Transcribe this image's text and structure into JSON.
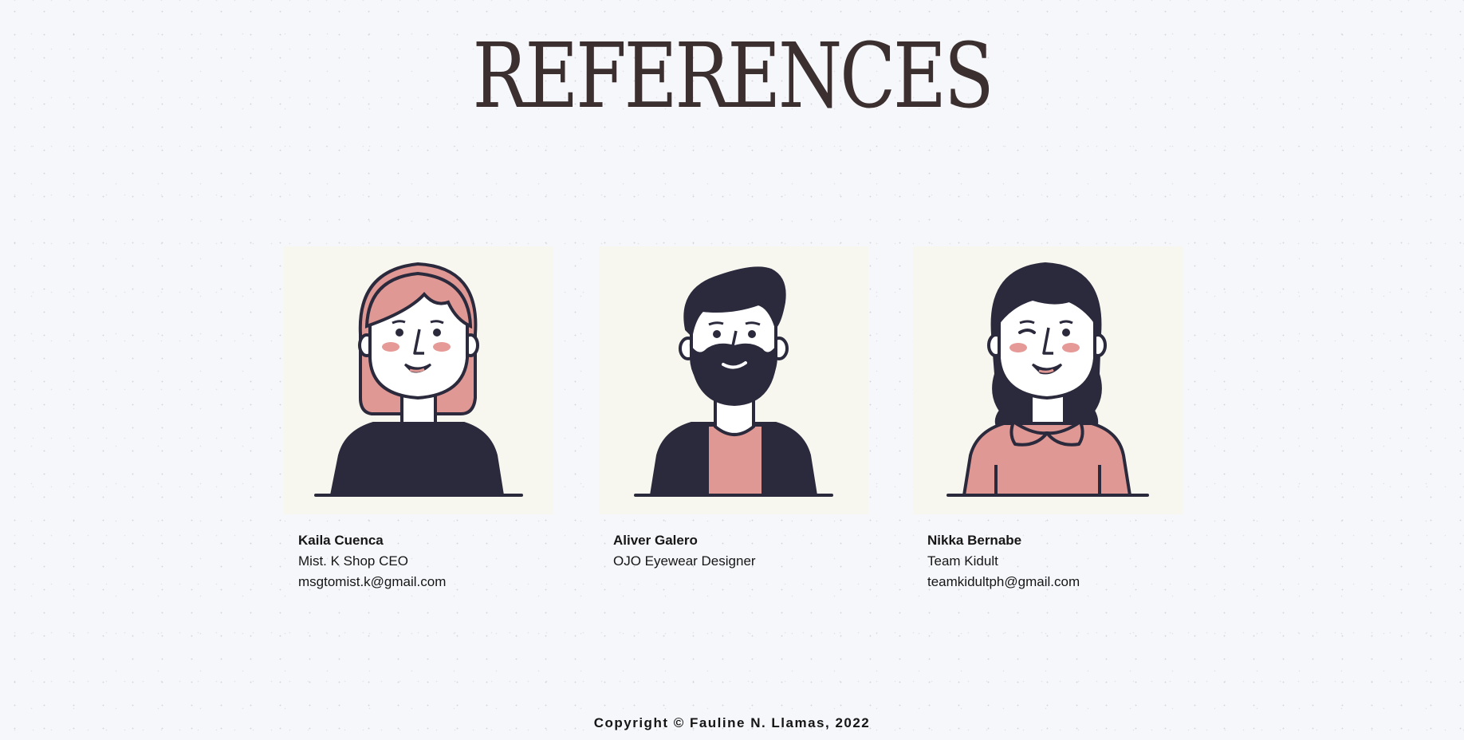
{
  "page": {
    "title": "REFERENCES"
  },
  "references": [
    {
      "name": "Kaila Cuenca",
      "role": "Mist. K Shop CEO",
      "email": "msgtomist.k@gmail.com",
      "avatar_icon": "woman-pink-bob-hair-avatar-icon"
    },
    {
      "name": "Aliver Galero",
      "role": "OJO Eyewear Designer",
      "email": "",
      "avatar_icon": "bearded-man-avatar-icon"
    },
    {
      "name": "Nikka Bernabe",
      "role": "Team Kidult",
      "email": "teamkidultph@gmail.com",
      "avatar_icon": "woman-long-dark-hair-avatar-icon"
    }
  ],
  "footer": {
    "copyright": "Copyright © Fauline N. Llamas, 2022"
  },
  "colors": {
    "background": "#f6f7fb",
    "card_background": "#f8f7ef",
    "title": "#3b2f2f",
    "ink": "#2b2a3d",
    "pink": "#e09894",
    "blush": "#e59a98"
  }
}
